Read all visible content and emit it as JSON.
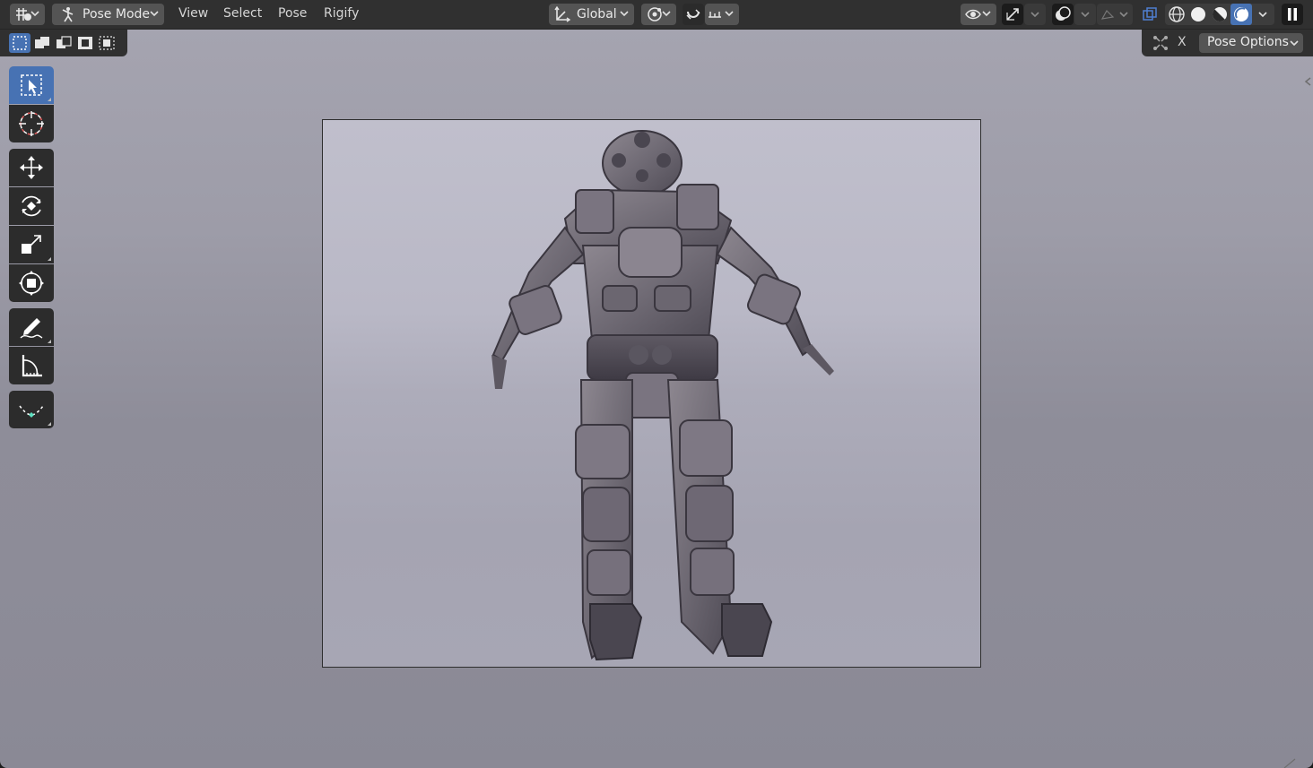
{
  "header": {
    "mode_label": "Pose Mode",
    "menu": [
      "View",
      "Select",
      "Pose",
      "Rigify"
    ],
    "transform_orientation": "Global"
  },
  "subbar": {
    "mirror_x_label": "X",
    "pose_options_label": "Pose Options"
  },
  "toolbar": {
    "tools": [
      "select-box",
      "cursor",
      "move",
      "rotate",
      "scale",
      "transform",
      "annotate",
      "measure",
      "relax-pose"
    ],
    "active_tool": "select-box"
  },
  "viewport": {
    "shading": "rendered",
    "accent": "#4772b3"
  }
}
